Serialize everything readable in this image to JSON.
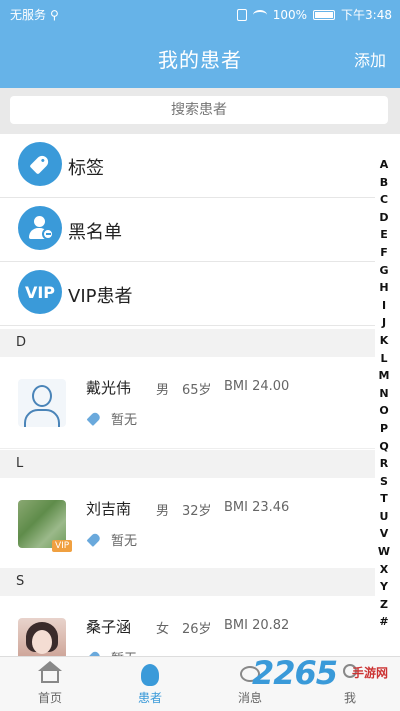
{
  "status_bar": {
    "carrier": "无服务",
    "battery": "100%",
    "time": "下午3:48"
  },
  "header": {
    "title": "我的患者",
    "add_label": "添加"
  },
  "search": {
    "placeholder": "搜索患者"
  },
  "entries": [
    {
      "label": "标签",
      "icon": "tag-icon"
    },
    {
      "label": "黑名单",
      "icon": "blacklist-icon"
    },
    {
      "label": "VIP患者",
      "icon": "vip-icon",
      "icon_text": "VIP"
    }
  ],
  "sections": [
    {
      "letter": "D",
      "patients": [
        {
          "name": "戴光伟",
          "gender": "男",
          "age": "65岁",
          "bmi": "BMI 24.00",
          "tag": "暂无",
          "vip": false
        }
      ]
    },
    {
      "letter": "L",
      "patients": [
        {
          "name": "刘吉南",
          "gender": "男",
          "age": "32岁",
          "bmi": "BMI 23.46",
          "tag": "暂无",
          "vip": true,
          "vip_label": "VIP"
        }
      ]
    },
    {
      "letter": "S",
      "patients": [
        {
          "name": "桑子涵",
          "gender": "女",
          "age": "26岁",
          "bmi": "BMI 20.82",
          "tag": "暂无",
          "vip": false
        }
      ]
    }
  ],
  "alphabet": [
    "A",
    "B",
    "C",
    "D",
    "E",
    "F",
    "G",
    "H",
    "I",
    "J",
    "K",
    "L",
    "M",
    "N",
    "O",
    "P",
    "Q",
    "R",
    "S",
    "T",
    "U",
    "V",
    "W",
    "X",
    "Y",
    "Z",
    "#"
  ],
  "bottom_nav": [
    {
      "label": "首页",
      "icon": "home-icon",
      "active": false
    },
    {
      "label": "患者",
      "icon": "patient-icon",
      "active": true
    },
    {
      "label": "消息",
      "icon": "message-icon",
      "active": false
    },
    {
      "label": "我",
      "icon": "profile-icon",
      "active": false
    }
  ],
  "watermark": {
    "text": "2265",
    "sub": "手游网"
  },
  "colors": {
    "header_blue": "#66b3e8",
    "accent_blue": "#3a9ad9",
    "vip_orange": "#f0a040"
  }
}
